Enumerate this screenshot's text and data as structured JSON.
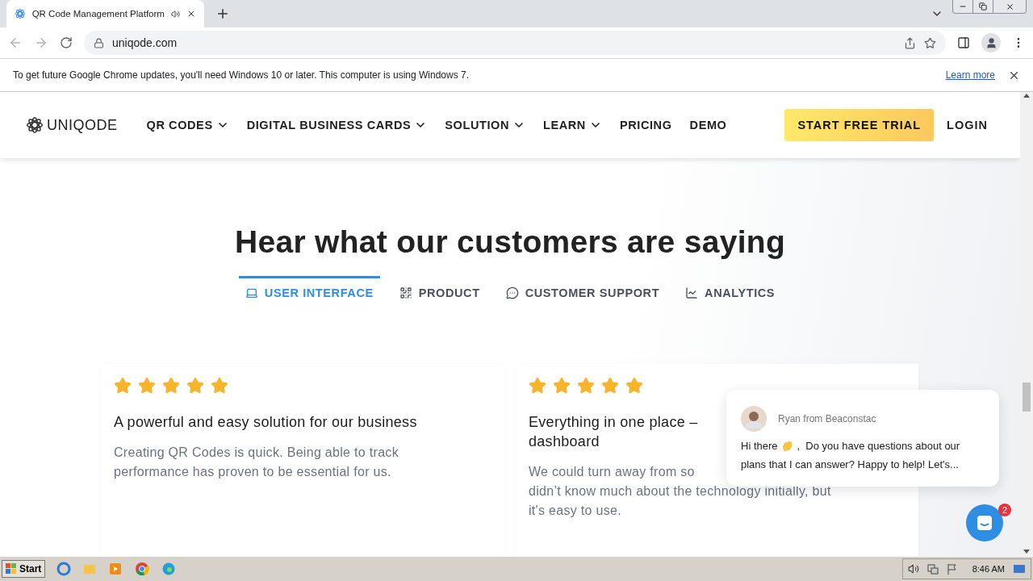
{
  "browser": {
    "tab": {
      "title": "QR Code Management Platform",
      "selected": true
    },
    "url": "uniqode.com"
  },
  "infobar": {
    "message": "To get future Google Chrome updates, you'll need Windows 10 or later. This computer is using Windows 7.",
    "link": "Learn more"
  },
  "site_nav": {
    "logo": "UNIQODE",
    "items": [
      {
        "label": "QR CODES",
        "dropdown": true
      },
      {
        "label": "DIGITAL BUSINESS CARDS",
        "dropdown": true
      },
      {
        "label": "SOLUTION",
        "dropdown": true
      },
      {
        "label": "LEARN",
        "dropdown": true
      },
      {
        "label": "PRICING",
        "dropdown": false
      },
      {
        "label": "DEMO",
        "dropdown": false
      }
    ],
    "cta": "START FREE TRIAL",
    "login": "LOGIN"
  },
  "heading": "Hear what our customers are saying",
  "category_tabs": [
    {
      "label": "USER INTERFACE",
      "kind": "laptop",
      "selected": true
    },
    {
      "label": "PRODUCT",
      "kind": "qr",
      "selected": false
    },
    {
      "label": "CUSTOMER SUPPORT",
      "kind": "chat",
      "selected": false
    },
    {
      "label": "ANALYTICS",
      "kind": "chart",
      "selected": false
    }
  ],
  "reviews": [
    {
      "stars": 5,
      "title_lines": [
        "A powerful and easy solution for our business"
      ],
      "body_lines": [
        "Creating QR Codes is quick. Being able to track",
        "performance has proven to be essential for us."
      ]
    },
    {
      "stars": 5,
      "title_lines": [
        "Everything in one place –",
        "dashboard"
      ],
      "body_lines": [
        "We could turn away from so",
        "didn’t know much about the technology initially, but",
        "it's easy to use."
      ]
    }
  ],
  "chat_popup": {
    "sender": "Ryan from Beaconstac",
    "greeting": "Hi there",
    "message_lines": [
      ",  Do you have questions about our",
      "plans that I can answer? Happy to help! Let's..."
    ]
  },
  "chat_launcher": {
    "badge": "2"
  },
  "taskbar": {
    "start": "Start",
    "time": "8:46 AM"
  }
}
